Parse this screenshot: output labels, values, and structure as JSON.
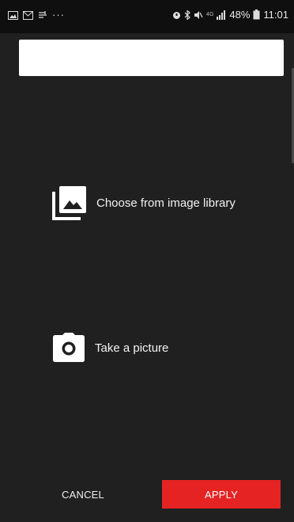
{
  "status_bar": {
    "battery": "48%",
    "time": "11:01"
  },
  "search": {
    "value": "",
    "placeholder": ""
  },
  "options": {
    "library_label": "Choose from image library",
    "camera_label": "Take a picture"
  },
  "actions": {
    "cancel_label": "CANCEL",
    "apply_label": "APPLY"
  },
  "colors": {
    "background": "#202020",
    "accent": "#e52323"
  }
}
